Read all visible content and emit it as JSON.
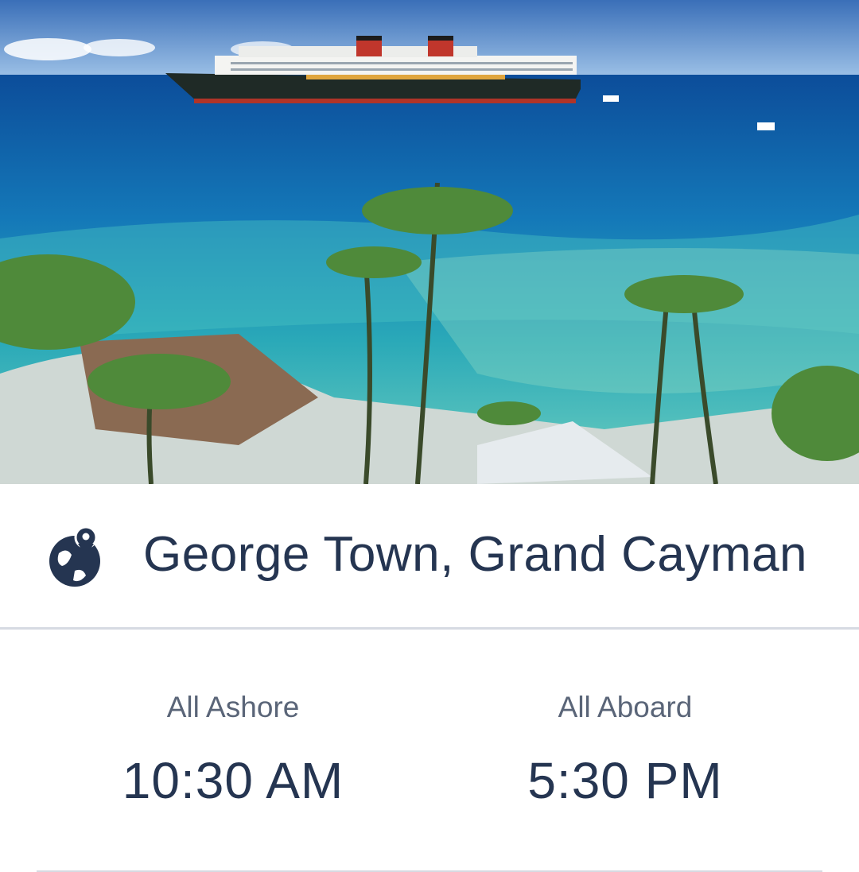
{
  "hero": {
    "alt": "Cruise ship anchored off a tropical beach with palm trees"
  },
  "port": {
    "name": "George Town, Grand Cayman",
    "icon": "globe-pin-icon"
  },
  "times": {
    "ashore": {
      "label": "All Ashore",
      "value": "10:30 AM"
    },
    "aboard": {
      "label": "All Aboard",
      "value": "5:30 PM"
    }
  },
  "colors": {
    "text_primary": "#253551",
    "text_secondary": "#5a6578",
    "divider": "#d6dae2"
  }
}
